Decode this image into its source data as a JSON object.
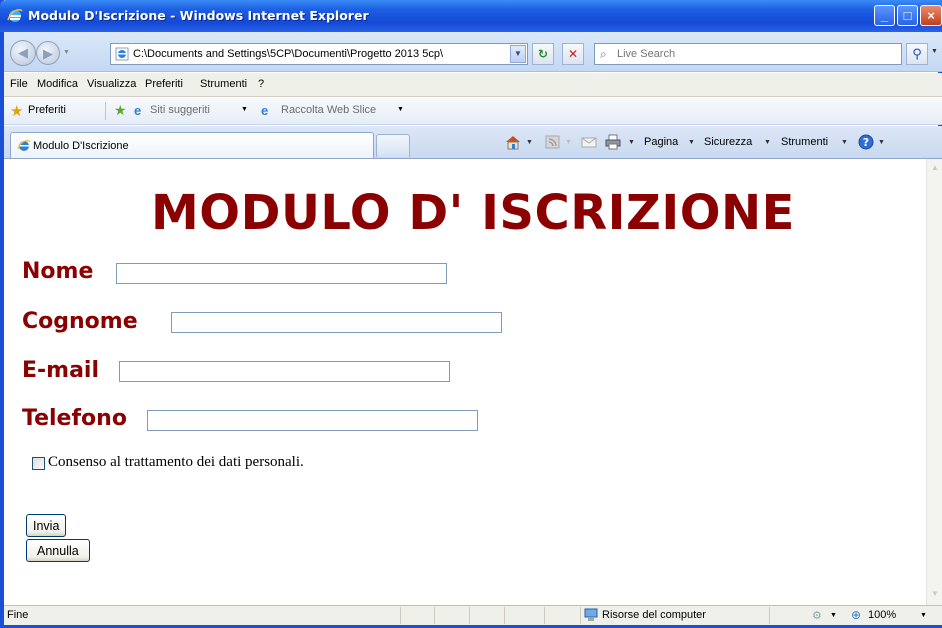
{
  "window": {
    "title": "Modulo D'Iscrizione - Windows Internet Explorer"
  },
  "address_bar": {
    "url": "C:\\Documents and Settings\\5CP\\Documenti\\Progetto 2013 5cp\\",
    "search_placeholder": "Live Search"
  },
  "menu": {
    "items": [
      "File",
      "Modifica",
      "Visualizza",
      "Preferiti",
      "Strumenti",
      "?"
    ]
  },
  "favorites_bar": {
    "favorites_label": "Preferiti",
    "suggested_label": "Siti suggeriti",
    "webslice_label": "Raccolta Web Slice"
  },
  "tabs": {
    "active_label": "Modulo D'Iscrizione"
  },
  "command_bar": {
    "page_label": "Pagina",
    "security_label": "Sicurezza",
    "tools_label": "Strumenti"
  },
  "form": {
    "title": "MODULO D' ISCRIZIONE",
    "fields": [
      {
        "label": "Nome",
        "value": ""
      },
      {
        "label": "Cognome",
        "value": ""
      },
      {
        "label": "E-mail",
        "value": ""
      },
      {
        "label": "Telefono",
        "value": ""
      }
    ],
    "consent_label": "Consenso al trattamento dei dati personali.",
    "consent_checked": false,
    "submit_label": "Invia",
    "reset_label": "Annulla"
  },
  "status_bar": {
    "status_text": "Fine",
    "zone_text": "Risorse del computer",
    "zoom_text": "100%"
  },
  "colors": {
    "heading": "#8b0000",
    "title_bar": "#1d5fe3"
  }
}
